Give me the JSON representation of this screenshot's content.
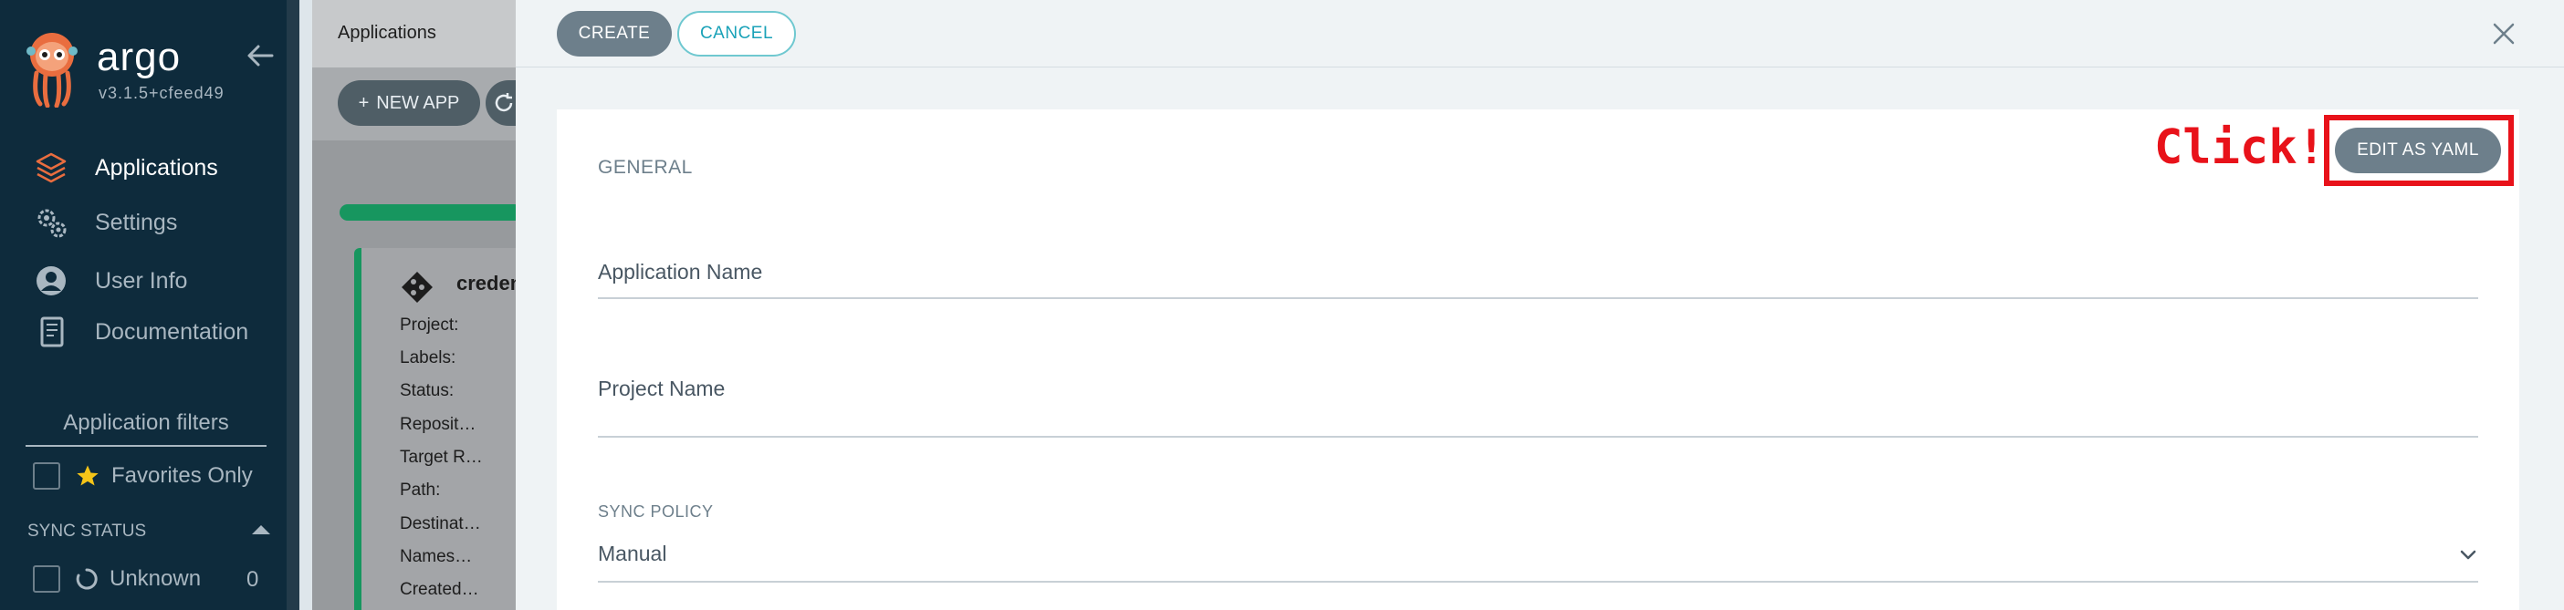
{
  "sidebar": {
    "brand": "argo",
    "version": "v3.1.5+cfeed49",
    "nav": [
      {
        "label": "Applications",
        "icon": "layers-icon",
        "active": true
      },
      {
        "label": "Settings",
        "icon": "gears-icon",
        "active": false
      },
      {
        "label": "User Info",
        "icon": "user-circle-icon",
        "active": false
      },
      {
        "label": "Documentation",
        "icon": "book-icon",
        "active": false
      }
    ],
    "filters_title": "Application filters",
    "favorites_label": "Favorites Only",
    "sync_status_label": "SYNC STATUS",
    "sync_items": [
      {
        "label": "Unknown",
        "count": "0"
      }
    ]
  },
  "background": {
    "page_title": "Applications",
    "new_app_label": "NEW APP",
    "card": {
      "name": "creden",
      "rows": [
        "Project:",
        "Labels:",
        "Status:",
        "Reposit…",
        "Target R…",
        "Path:",
        "Destinat…",
        "Names…",
        "Created…"
      ]
    }
  },
  "panel": {
    "create_label": "CREATE",
    "cancel_label": "CANCEL",
    "edit_yaml_label": "EDIT AS YAML",
    "annotation": "Click!",
    "general_title": "GENERAL",
    "app_name_label": "Application Name",
    "project_name_label": "Project Name",
    "sync_policy_title": "SYNC POLICY",
    "sync_policy_value": "Manual"
  },
  "colors": {
    "sidebar_bg": "#0e2b3c",
    "accent_teal": "#17965f",
    "button_gray": "#6d7f8b",
    "highlight_red": "#e8121a"
  }
}
